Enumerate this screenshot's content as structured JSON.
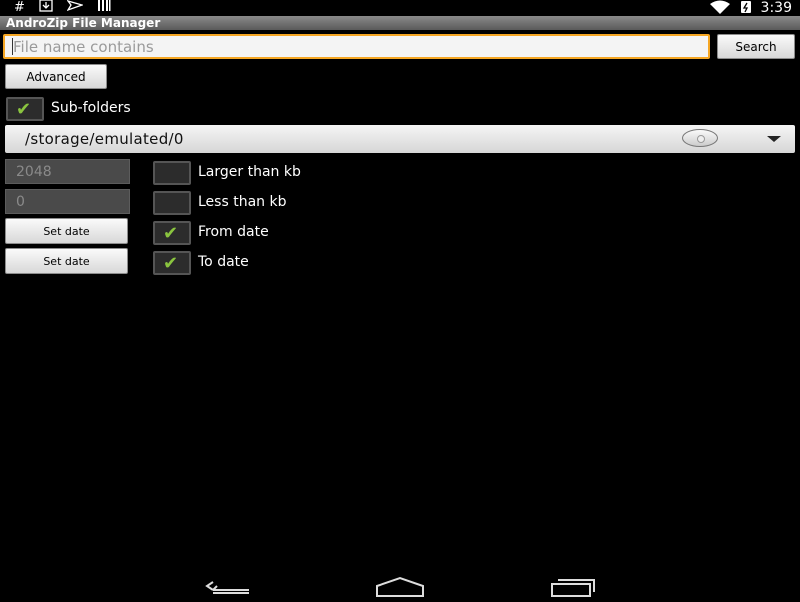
{
  "statusbar": {
    "left_icons": [
      "hash-icon",
      "download-icon",
      "send-icon",
      "barcode-icon"
    ],
    "right_icons": [
      "wifi-icon",
      "battery-icon"
    ],
    "time": "3:39"
  },
  "app": {
    "title": "AndroZip File Manager"
  },
  "search": {
    "placeholder": "File name contains",
    "value": "",
    "button_label": "Search"
  },
  "advanced_label": "Advanced",
  "subfolders": {
    "label": "Sub-folders",
    "checked": true
  },
  "path": {
    "value": "/storage/emulated/0"
  },
  "filters": {
    "larger": {
      "value": "2048",
      "label": "Larger than kb",
      "checked": false
    },
    "less": {
      "value": "0",
      "label": "Less than kb",
      "checked": false
    },
    "from_date": {
      "button_label": "Set date",
      "label": "From date",
      "checked": true
    },
    "to_date": {
      "button_label": "Set date",
      "label": "To date",
      "checked": true
    }
  },
  "navbar": {
    "icons": [
      "back-icon",
      "home-icon",
      "recent-apps-icon"
    ]
  },
  "colors": {
    "accent_focus": "#f5a623",
    "check": "#8ac43f",
    "background": "#000000"
  }
}
